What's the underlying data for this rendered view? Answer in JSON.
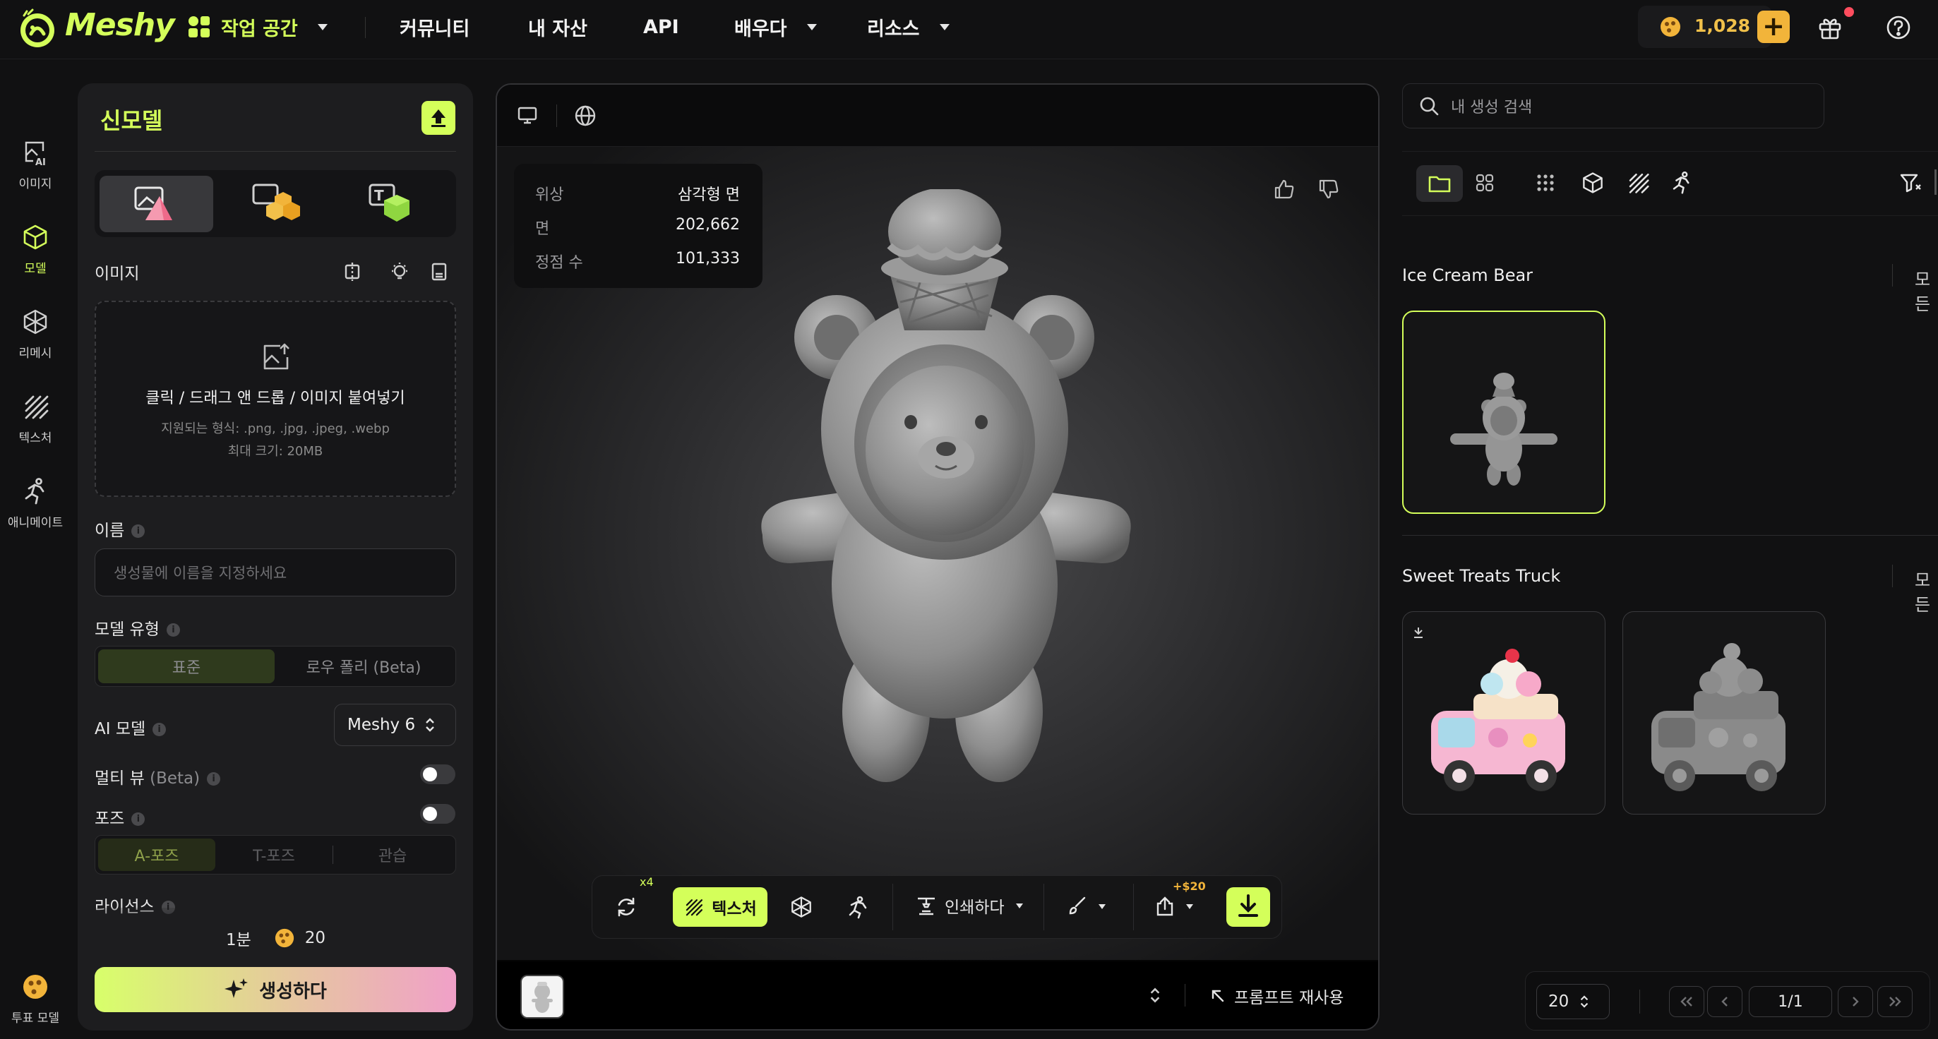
{
  "app": {
    "name": "Meshy"
  },
  "nav": {
    "workspace": "작업 공간",
    "community": "커뮤니티",
    "assets": "내 자산",
    "api": "API",
    "learn": "배우다",
    "resources": "리소스",
    "credits": "1,028"
  },
  "rail": {
    "image": "이미지",
    "model": "모델",
    "remesh": "리메시",
    "texture": "텍스처",
    "animate": "애니메이트",
    "vote": "투표 모델"
  },
  "panel": {
    "title": "신모델",
    "image_label": "이미지",
    "dropzone_main": "클릭 / 드래그 앤 드롭 / 이미지 붙여넣기",
    "dropzone_formats": "지원되는 형식: .png, .jpg, .jpeg, .webp",
    "dropzone_size": "최대 크기: 20MB",
    "name_label": "이름",
    "name_placeholder": "생성물에 이름을 지정하세요",
    "model_type_label": "모델 유형",
    "model_type_options": [
      "표준",
      "로우 폴리 (Beta)"
    ],
    "model_type_selected": "표준",
    "ai_model_label": "AI 모델",
    "ai_model_value": "Meshy 6",
    "multiview_label": "멀티 뷰",
    "multiview_beta": "(Beta)",
    "multiview_on": false,
    "pose_label": "포즈",
    "pose_on": false,
    "pose_options": [
      "A-포즈",
      "T-포즈",
      "관습"
    ],
    "pose_selected": "A-포즈",
    "license_label": "라이선스",
    "time_estimate": "1분",
    "cost": "20",
    "generate_label": "생성하다"
  },
  "viewer": {
    "stats": [
      {
        "key": "위상",
        "value": "삼각형 면"
      },
      {
        "key": "면",
        "value": "202,662"
      },
      {
        "key": "정점 수",
        "value": "101,333"
      }
    ],
    "toolbar": {
      "refresh_badge": "x4",
      "texture_label": "텍스처",
      "print_label": "인쇄하다",
      "export_badge": "+$20"
    },
    "reuse_prompt": "프롬프트 재사용"
  },
  "right": {
    "search_placeholder": "내 생성 검색",
    "groups": [
      {
        "title": "Ice Cream Bear",
        "tag": "모든"
      },
      {
        "title": "Sweet Treats Truck",
        "tag": "모든"
      }
    ],
    "pager": {
      "per_page": "20",
      "page": "1/1"
    }
  },
  "colors": {
    "accent": "#d4ff5a",
    "gold": "#f2b43a"
  }
}
